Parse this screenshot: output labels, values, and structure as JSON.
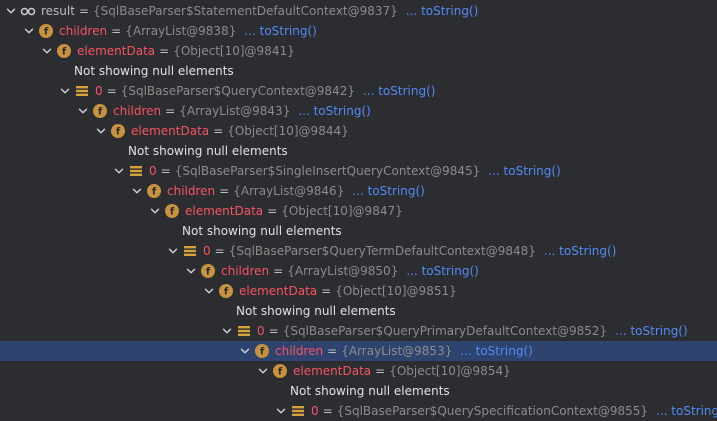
{
  "rows": [
    {
      "indent": 0,
      "expanded": true,
      "icon": "watch-glasses-icon",
      "name": "result",
      "name_style": "result",
      "value": "{SqlBaseParser$StatementDefaultContext@9837}",
      "link": "... toString()"
    },
    {
      "indent": 1,
      "expanded": true,
      "icon": "field-icon",
      "name": "children",
      "name_style": "field",
      "value": "{ArrayList@9838}",
      "link": "... toString()"
    },
    {
      "indent": 2,
      "expanded": true,
      "icon": "field-icon",
      "name": "elementData",
      "name_style": "field",
      "value": "{Object[10]@9841}",
      "link": ""
    },
    {
      "indent": 3,
      "expanded": null,
      "icon": "",
      "name": "",
      "name_style": "",
      "value": "",
      "link": "",
      "plain": "Not showing null elements"
    },
    {
      "indent": 3,
      "expanded": true,
      "icon": "array-element-icon",
      "name": "0",
      "name_style": "index",
      "value": "{SqlBaseParser$QueryContext@9842}",
      "link": "... toString()"
    },
    {
      "indent": 4,
      "expanded": true,
      "icon": "field-icon",
      "name": "children",
      "name_style": "field",
      "value": "{ArrayList@9843}",
      "link": "... toString()"
    },
    {
      "indent": 5,
      "expanded": true,
      "icon": "field-icon",
      "name": "elementData",
      "name_style": "field",
      "value": "{Object[10]@9844}",
      "link": ""
    },
    {
      "indent": 6,
      "expanded": null,
      "icon": "",
      "name": "",
      "name_style": "",
      "value": "",
      "link": "",
      "plain": "Not showing null elements"
    },
    {
      "indent": 6,
      "expanded": true,
      "icon": "array-element-icon",
      "name": "0",
      "name_style": "index",
      "value": "{SqlBaseParser$SingleInsertQueryContext@9845}",
      "link": "... toString()"
    },
    {
      "indent": 7,
      "expanded": true,
      "icon": "field-icon",
      "name": "children",
      "name_style": "field",
      "value": "{ArrayList@9846}",
      "link": "... toString()"
    },
    {
      "indent": 8,
      "expanded": true,
      "icon": "field-icon",
      "name": "elementData",
      "name_style": "field",
      "value": "{Object[10]@9847}",
      "link": ""
    },
    {
      "indent": 9,
      "expanded": null,
      "icon": "",
      "name": "",
      "name_style": "",
      "value": "",
      "link": "",
      "plain": "Not showing null elements"
    },
    {
      "indent": 9,
      "expanded": true,
      "icon": "array-element-icon",
      "name": "0",
      "name_style": "index",
      "value": "{SqlBaseParser$QueryTermDefaultContext@9848}",
      "link": "... toString()"
    },
    {
      "indent": 10,
      "expanded": true,
      "icon": "field-icon",
      "name": "children",
      "name_style": "field",
      "value": "{ArrayList@9850}",
      "link": "... toString()"
    },
    {
      "indent": 11,
      "expanded": true,
      "icon": "field-icon",
      "name": "elementData",
      "name_style": "field",
      "value": "{Object[10]@9851}",
      "link": ""
    },
    {
      "indent": 12,
      "expanded": null,
      "icon": "",
      "name": "",
      "name_style": "",
      "value": "",
      "link": "",
      "plain": "Not showing null elements"
    },
    {
      "indent": 12,
      "expanded": true,
      "icon": "array-element-icon",
      "name": "0",
      "name_style": "index",
      "value": "{SqlBaseParser$QueryPrimaryDefaultContext@9852}",
      "link": "... toString()"
    },
    {
      "indent": 13,
      "expanded": true,
      "icon": "field-icon",
      "name": "children",
      "name_style": "field",
      "value": "{ArrayList@9853}",
      "link": "... toString()",
      "selected": true
    },
    {
      "indent": 14,
      "expanded": true,
      "icon": "field-icon",
      "name": "elementData",
      "name_style": "field",
      "value": "{Object[10]@9854}",
      "link": ""
    },
    {
      "indent": 15,
      "expanded": null,
      "icon": "",
      "name": "",
      "name_style": "",
      "value": "",
      "link": "",
      "plain": "Not showing null elements"
    },
    {
      "indent": 15,
      "expanded": true,
      "icon": "array-element-icon",
      "name": "0",
      "name_style": "index",
      "value": "{SqlBaseParser$QuerySpecificationContext@9855}",
      "link": "... toString()"
    }
  ],
  "colors": {
    "background": "#2b2d30",
    "field_name": "#f75464",
    "type_text": "#8c8c8c",
    "link": "#548af7",
    "selected_row": "#2e436e",
    "field_icon_fill": "#c8923e",
    "array_icon_fill": "#d4a13c"
  }
}
